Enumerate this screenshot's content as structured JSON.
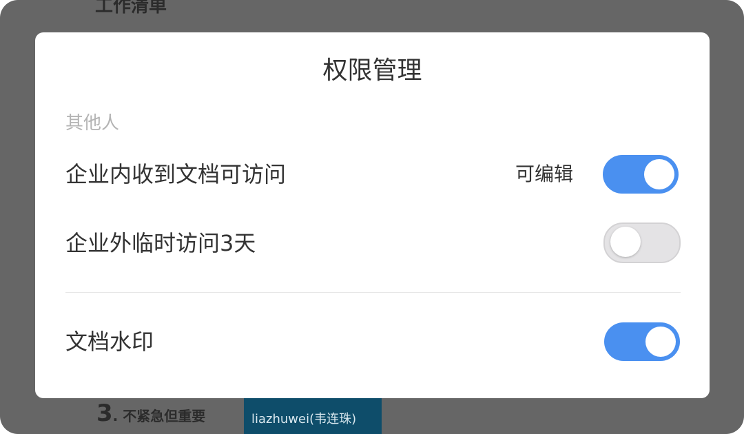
{
  "background": {
    "heading": "工作清单",
    "footer_number": "3",
    "footer_label": ". 不紧急但重要",
    "chip_text": "liazhuwei(韦连珠)"
  },
  "dialog": {
    "title": "权限管理",
    "section_label": "其他人",
    "rows": [
      {
        "label": "企业内收到文档可访问",
        "value": "可编辑",
        "toggle_on": true
      },
      {
        "label": "企业外临时访问3天",
        "toggle_on": false
      },
      {
        "label": "文档水印",
        "toggle_on": true
      }
    ]
  },
  "colors": {
    "toggle_on": "#4a90f0",
    "toggle_off": "#e4e3e5",
    "overlay": "#666666"
  }
}
